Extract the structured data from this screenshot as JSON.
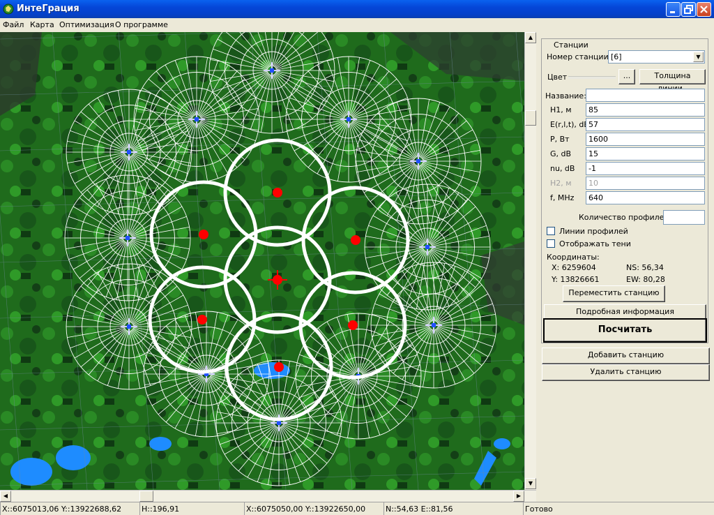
{
  "window": {
    "title": "ИнтеГрация"
  },
  "menu": [
    "Файл",
    "Карта",
    "Оптимизация",
    "О программе"
  ],
  "stations_panel": {
    "group_title": "Станции",
    "station_number_label": "Номер станции:",
    "station_number_value": "[6]",
    "color_label": "Цвет",
    "color_button": "...",
    "line_width_button": "Толщина линии..",
    "name_label": "Название:",
    "name_value": "",
    "params": [
      {
        "label": "H1, м",
        "value": "85",
        "disabled": false
      },
      {
        "label": "E(r,l,t), dB",
        "value": "57",
        "disabled": false
      },
      {
        "label": "P, Вт",
        "value": "1600",
        "disabled": false
      },
      {
        "label": "G, dB",
        "value": "15",
        "disabled": false
      },
      {
        "label": "nu, dB",
        "value": "-1",
        "disabled": false
      },
      {
        "label": "H2, м",
        "value": "10",
        "disabled": true
      },
      {
        "label": "f, MHz",
        "value": "640",
        "disabled": false
      }
    ],
    "profiles_count_label": "Количество профилей",
    "profiles_count_value": "",
    "profile_lines_label": "Линии профилей",
    "profile_lines_checked": false,
    "show_shadows_label": "Отображать тени",
    "show_shadows_checked": false,
    "coords_title": "Координаты:",
    "coord_x": "X: 6259604",
    "coord_y": "Y: 13826661",
    "coord_ns": "NS: 56,34",
    "coord_ew": "EW: 80,28",
    "move_station_button": "Переместить станцию",
    "details_button": "Подробная информация",
    "calculate_button": "Посчитать"
  },
  "add_station_button": "Добавить станцию",
  "delete_station_button": "Удалить станцию",
  "statusbar": [
    "X::6075013,06 Y::13922688,62",
    "H::196,91",
    "X::6075050,00 Y::13922650,00",
    "N::54,63 E::81,56",
    "Готово"
  ],
  "colors": {
    "title_bar": "#0a5ae8",
    "map_green": "#1e7a1e",
    "station_red": "#ff0000",
    "coverage_white": "#ffffff"
  },
  "map": {
    "description_icons": [
      "station-marker",
      "coverage-circle"
    ]
  }
}
